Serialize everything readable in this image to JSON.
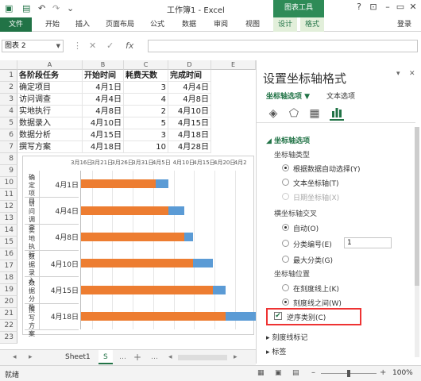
{
  "window": {
    "title": "工作簿1 - Excel",
    "context_tab_title": "图表工具"
  },
  "ribbon": {
    "tabs": [
      "文件",
      "开始",
      "插入",
      "页面布局",
      "公式",
      "数据",
      "审阅",
      "视图",
      "设计",
      "格式"
    ],
    "user": "登录"
  },
  "formula_bar": {
    "name_box": "图表 2",
    "fx": "fx"
  },
  "sheet": {
    "columns": [
      "A",
      "B",
      "C",
      "D",
      "E"
    ],
    "rows": [
      "1",
      "2",
      "3",
      "4",
      "5",
      "6",
      "7",
      "8",
      "9",
      "10",
      "11",
      "12",
      "13",
      "14",
      "15",
      "16",
      "17",
      "18",
      "19",
      "20",
      "21",
      "22",
      "23"
    ],
    "header": [
      "各阶段任务",
      "开始时间",
      "耗费天数",
      "完成时间"
    ],
    "data": [
      [
        "确定项目",
        "4月1日",
        "3",
        "4月4日"
      ],
      [
        "访问调查",
        "4月4日",
        "4",
        "4月8日"
      ],
      [
        "实地执行",
        "4月8日",
        "2",
        "4月10日"
      ],
      [
        "数据录入",
        "4月10日",
        "5",
        "4月15日"
      ],
      [
        "数据分析",
        "4月15日",
        "3",
        "4月18日"
      ],
      [
        "撰写方案",
        "4月18日",
        "10",
        "4月28日"
      ]
    ]
  },
  "chart_data": {
    "type": "bar",
    "stacked": true,
    "orientation": "horizontal",
    "x_tick_labels": [
      "3月16日",
      "3月21日",
      "3月26日",
      "3月31日",
      "4月5日",
      "4月10日",
      "4月15日",
      "4月20日",
      "4月2"
    ],
    "categories": [
      {
        "task": "确定项目",
        "date": "4月1日"
      },
      {
        "task": "访问调查",
        "date": "4月4日"
      },
      {
        "task": "实地执行",
        "date": "4月8日"
      },
      {
        "task": "数据录入",
        "date": "4月10日"
      },
      {
        "task": "数据分析",
        "date": "4月15日"
      },
      {
        "task": "撰写方案",
        "date": "4月18日"
      }
    ],
    "series": [
      {
        "values": [
          "4月1日",
          "4月4日",
          "4月8日",
          "4月10日",
          "4月15日",
          "4月18日"
        ],
        "color": "#ed7d31"
      },
      {
        "values": [
          3,
          4,
          2,
          5,
          3,
          10
        ],
        "color": "#5b9bd5"
      }
    ],
    "reverse_order": true
  },
  "sheet_tabs": {
    "items": [
      "Sheet1",
      "S"
    ],
    "add": "+"
  },
  "status": {
    "text": "就绪",
    "zoom": "100%"
  },
  "format_pane": {
    "title": "设置坐标轴格式",
    "tab_axis": "坐标轴选项",
    "tab_text": "文本选项",
    "section_axis": "坐标轴选项",
    "axis_type_label": "坐标轴类型",
    "axis_type_options": [
      "根据数据自动选择(Y)",
      "文本坐标轴(T)",
      "日期坐标轴(X)"
    ],
    "cross_label": "横坐标轴交叉",
    "cross_options": [
      "自动(O)",
      "分类编号(E)",
      "最大分类(G)"
    ],
    "cross_number": "1",
    "position_label": "坐标轴位置",
    "position_options": [
      "在刻度线上(K)",
      "刻度线之间(W)"
    ],
    "reverse_label": "逆序类别(C)",
    "tickmarks_label": "刻度线标记",
    "labels_label": "标签"
  }
}
